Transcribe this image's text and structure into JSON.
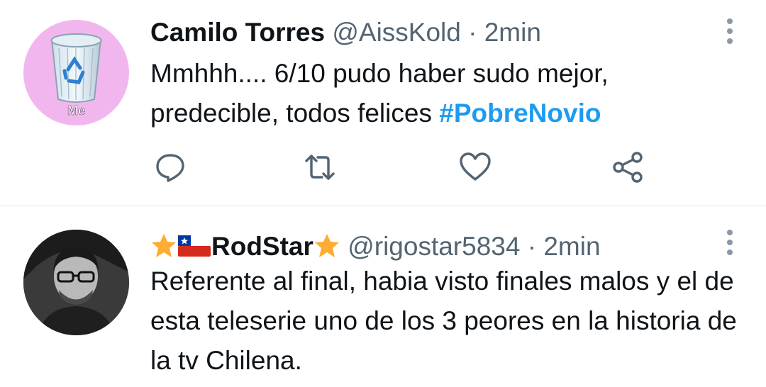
{
  "tweets": [
    {
      "name": "Camilo Torres",
      "handle": "@AissKold",
      "separator": "·",
      "time": "2min",
      "text": "Mmhhh.... 6/10 pudo haber sudo mejor, predecible, todos felices",
      "hashtag": "#PobreNovio",
      "avatar_label": "Me",
      "avatar_icon": "recycle-bin-icon",
      "avatar_bg": "#f2b6ef"
    },
    {
      "name": "RodStar",
      "name_decorations": [
        "star-emoji",
        "chile-flag-emoji",
        "star-emoji"
      ],
      "handle": "@rigostar5834",
      "separator": "·",
      "time": "2min",
      "text": "Referente al final, habia visto finales malos y el de esta teleserie uno de los 3 peores en la historia de la tv Chilena.",
      "avatar_icon": "profile-photo"
    }
  ],
  "actions": [
    "reply-icon",
    "retweet-icon",
    "like-icon",
    "share-icon"
  ],
  "colors": {
    "hashtag": "#1d9bf0",
    "secondary_text": "#536471",
    "icon": "#536471",
    "divider": "#e6e9eb"
  }
}
